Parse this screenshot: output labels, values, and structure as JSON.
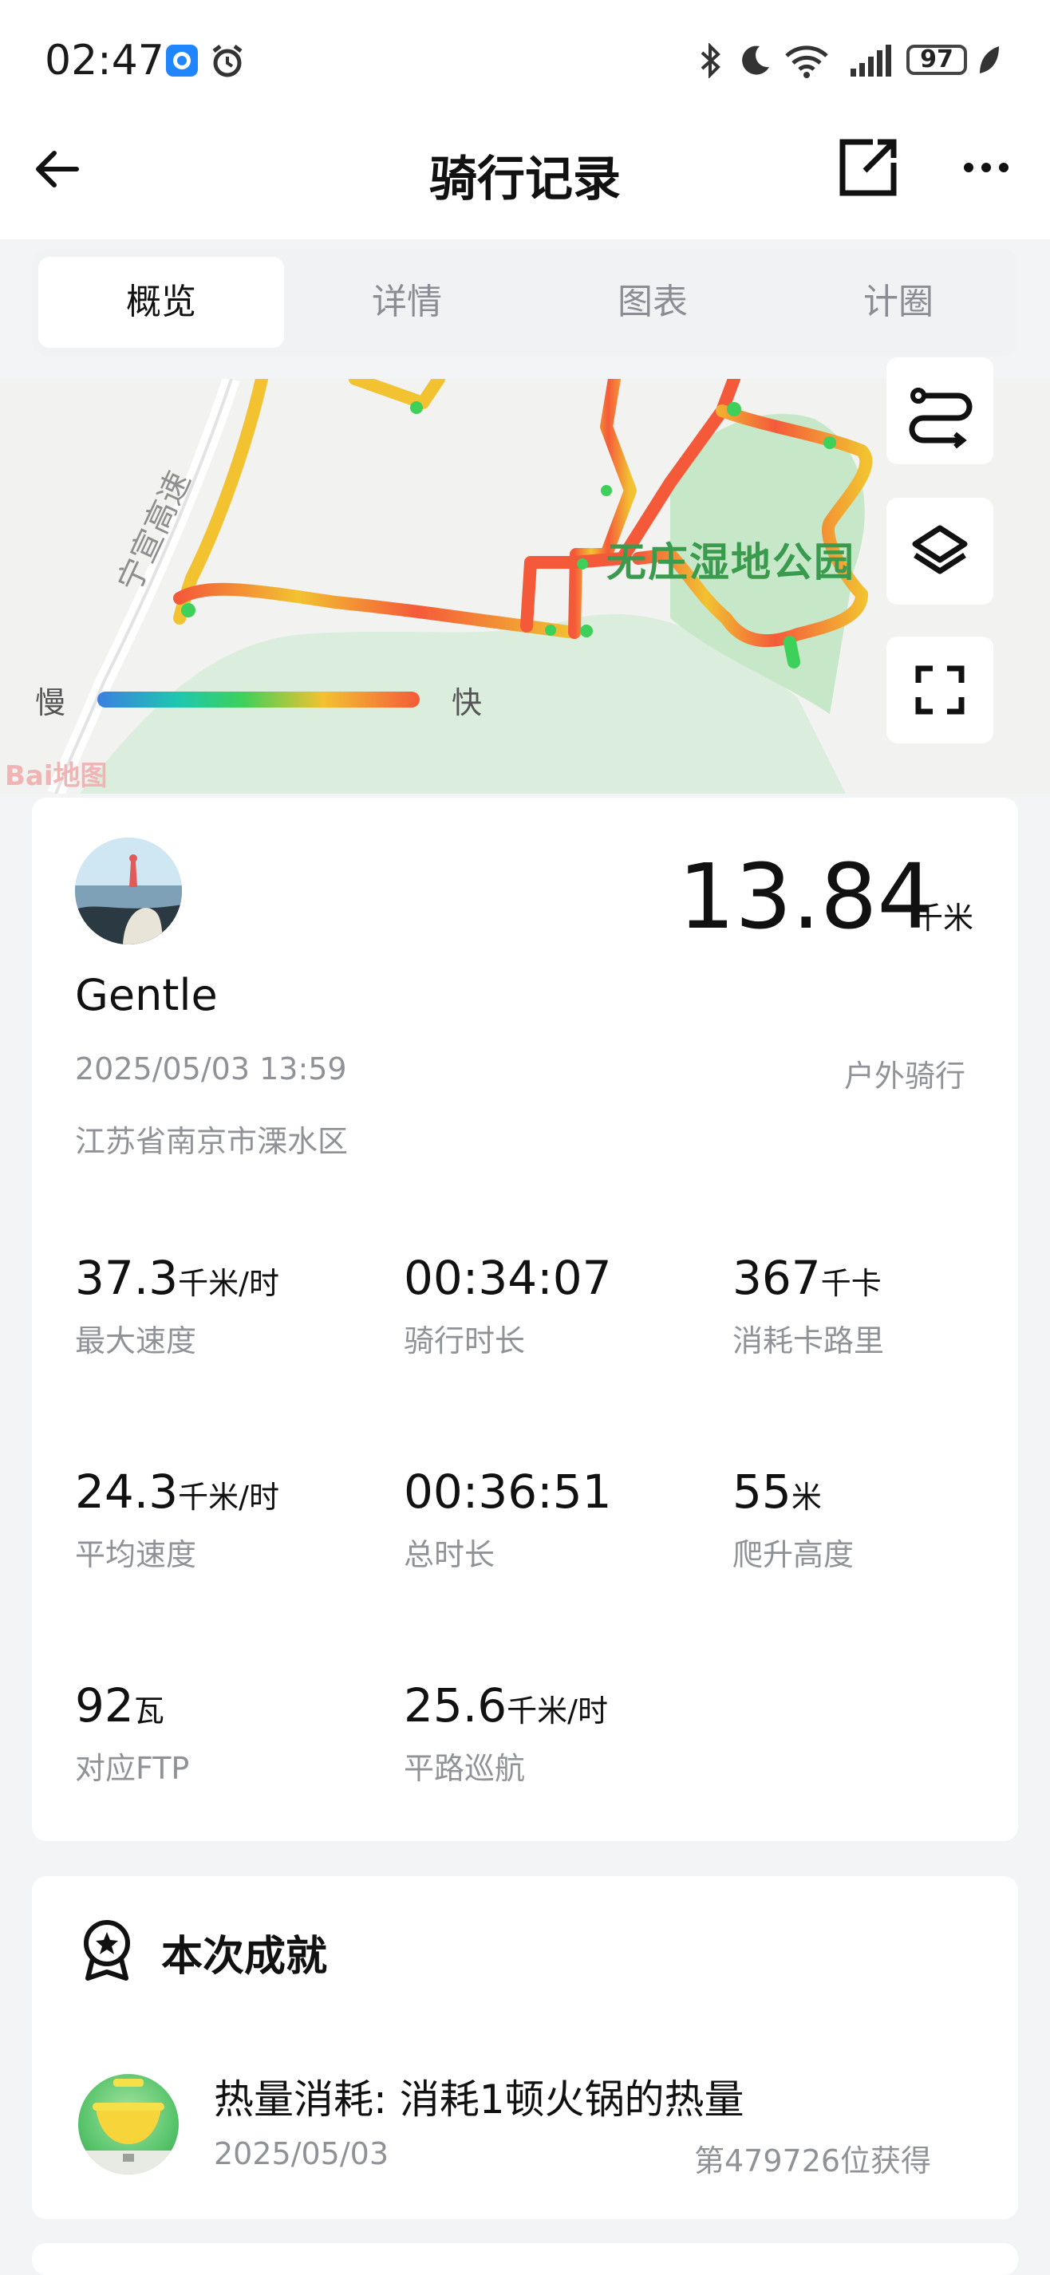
{
  "status_bar": {
    "time": "02:47",
    "battery": "97"
  },
  "header": {
    "title": "骑行记录"
  },
  "tabs": [
    {
      "label": "概览"
    },
    {
      "label": "详情"
    },
    {
      "label": "图表"
    },
    {
      "label": "计圈"
    }
  ],
  "map": {
    "park_label": "无庄湿地公园",
    "road_label": "宁宣高速",
    "speed_slow": "慢",
    "speed_fast": "快",
    "watermark": "Bai地图"
  },
  "summary": {
    "username": "Gentle",
    "distance": "13.84",
    "distance_unit": "千米",
    "datetime": "2025/05/03 13:59",
    "activity_type": "户外骑行",
    "location": "江苏省南京市溧水区"
  },
  "stats": [
    {
      "value": "37.3",
      "unit": "千米/时",
      "label": "最大速度"
    },
    {
      "value": "00:34:07",
      "unit": "",
      "label": "骑行时长"
    },
    {
      "value": "367",
      "unit": "千卡",
      "label": "消耗卡路里"
    },
    {
      "value": "24.3",
      "unit": "千米/时",
      "label": "平均速度"
    },
    {
      "value": "00:36:51",
      "unit": "",
      "label": "总时长"
    },
    {
      "value": "55",
      "unit": "米",
      "label": "爬升高度"
    },
    {
      "value": "92",
      "unit": "瓦",
      "label": "对应FTP"
    },
    {
      "value": "25.6",
      "unit": "千米/时",
      "label": "平路巡航"
    }
  ],
  "achievements": {
    "title": "本次成就",
    "item": {
      "name": "热量消耗: 消耗1顿火锅的热量",
      "date": "2025/05/03",
      "rank": "第479726位获得"
    }
  },
  "colors": {
    "accent_green": "#3dd05a",
    "route_red": "#f45a3a",
    "route_yellow": "#f2c230"
  }
}
